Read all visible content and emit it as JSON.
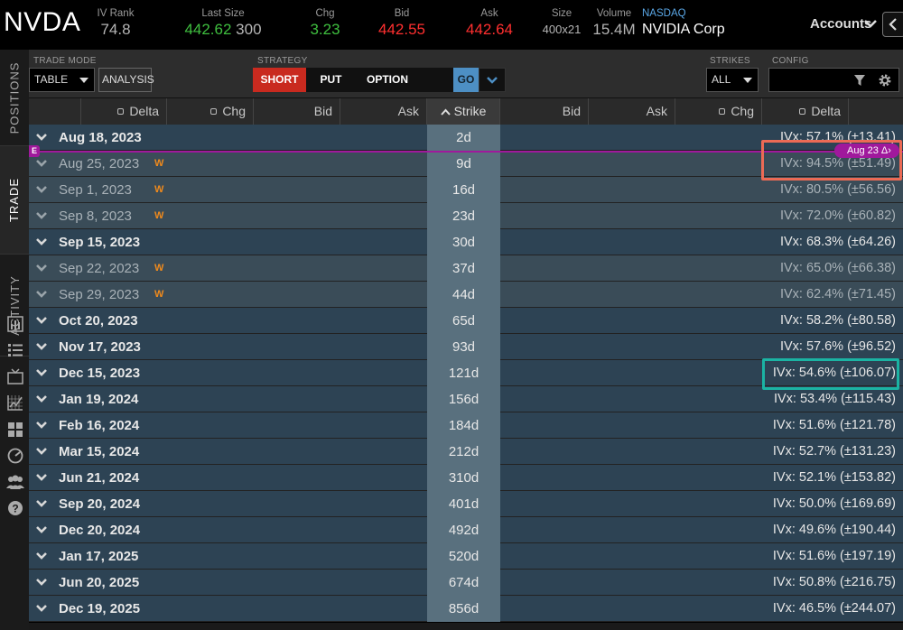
{
  "quote": {
    "symbol": "NVDA",
    "iv_rank": {
      "label": "IV Rank",
      "value": "74.8"
    },
    "last_size": {
      "label": "Last Size",
      "price": "442.62",
      "size": "300"
    },
    "chg": {
      "label": "Chg",
      "value": "3.23"
    },
    "bid": {
      "label": "Bid",
      "value": "442.55"
    },
    "ask": {
      "label": "Ask",
      "value": "442.64"
    },
    "size": {
      "label": "Size",
      "value": "400x21"
    },
    "volume": {
      "label": "Volume",
      "value": "15.4M"
    },
    "exchange": {
      "label": "NASDAQ",
      "name": "NVIDIA Corp"
    },
    "accounts_label": "Accounts"
  },
  "toolbar": {
    "trade_mode": {
      "label": "TRADE MODE",
      "value": "TABLE",
      "analysis": "ANALYSIS"
    },
    "strategy": {
      "label": "STRATEGY",
      "short": "SHORT",
      "put": "PUT",
      "option": "OPTION",
      "go": "GO"
    },
    "strikes": {
      "label": "STRIKES",
      "value": "ALL"
    },
    "config": {
      "label": "CONFIG"
    }
  },
  "rail": {
    "tabs": [
      "POSITIONS",
      "TRADE",
      "ACTIVITY"
    ],
    "icons": [
      "chart-icon",
      "list-icon",
      "tv-icon",
      "heatmap-icon",
      "grid-icon",
      "gauge-icon",
      "users-icon",
      "help-icon"
    ]
  },
  "table": {
    "headers": {
      "call_delta": "Delta",
      "call_chg": "Chg",
      "call_bid": "Bid",
      "call_ask": "Ask",
      "strike": "Strike",
      "put_bid": "Bid",
      "put_ask": "Ask",
      "put_chg": "Chg",
      "put_delta": "Delta"
    },
    "rows": [
      {
        "date": "Aug 18, 2023",
        "weekly": "",
        "dte": "2d",
        "ivx": "IVx: 57.1% (±13.41)",
        "type": "monthly"
      },
      {
        "date": "Aug 25, 2023",
        "weekly": "W",
        "dte": "9d",
        "ivx": "IVx: 94.5% (±51.49)",
        "type": "weekly"
      },
      {
        "date": "Sep 1, 2023",
        "weekly": "W",
        "dte": "16d",
        "ivx": "IVx: 80.5% (±56.56)",
        "type": "weekly"
      },
      {
        "date": "Sep 8, 2023",
        "weekly": "W",
        "dte": "23d",
        "ivx": "IVx: 72.0% (±60.82)",
        "type": "weekly"
      },
      {
        "date": "Sep 15, 2023",
        "weekly": "",
        "dte": "30d",
        "ivx": "IVx: 68.3% (±64.26)",
        "type": "monthly"
      },
      {
        "date": "Sep 22, 2023",
        "weekly": "W",
        "dte": "37d",
        "ivx": "IVx: 65.0% (±66.38)",
        "type": "weekly"
      },
      {
        "date": "Sep 29, 2023",
        "weekly": "W",
        "dte": "44d",
        "ivx": "IVx: 62.4% (±71.45)",
        "type": "weekly"
      },
      {
        "date": "Oct 20, 2023",
        "weekly": "",
        "dte": "65d",
        "ivx": "IVx: 58.2% (±80.58)",
        "type": "monthly"
      },
      {
        "date": "Nov 17, 2023",
        "weekly": "",
        "dte": "93d",
        "ivx": "IVx: 57.6% (±96.52)",
        "type": "monthly"
      },
      {
        "date": "Dec 15, 2023",
        "weekly": "",
        "dte": "121d",
        "ivx": "IVx: 54.6% (±106.07)",
        "type": "monthly"
      },
      {
        "date": "Jan 19, 2024",
        "weekly": "",
        "dte": "156d",
        "ivx": "IVx: 53.4% (±115.43)",
        "type": "monthly"
      },
      {
        "date": "Feb 16, 2024",
        "weekly": "",
        "dte": "184d",
        "ivx": "IVx: 51.6% (±121.78)",
        "type": "monthly"
      },
      {
        "date": "Mar 15, 2024",
        "weekly": "",
        "dte": "212d",
        "ivx": "IVx: 52.7% (±131.23)",
        "type": "monthly"
      },
      {
        "date": "Jun 21, 2024",
        "weekly": "",
        "dte": "310d",
        "ivx": "IVx: 52.1% (±153.82)",
        "type": "monthly"
      },
      {
        "date": "Sep 20, 2024",
        "weekly": "",
        "dte": "401d",
        "ivx": "IVx: 50.0% (±169.69)",
        "type": "monthly"
      },
      {
        "date": "Dec 20, 2024",
        "weekly": "",
        "dte": "492d",
        "ivx": "IVx: 49.6% (±190.44)",
        "type": "monthly"
      },
      {
        "date": "Jan 17, 2025",
        "weekly": "",
        "dte": "520d",
        "ivx": "IVx: 51.6% (±197.19)",
        "type": "monthly"
      },
      {
        "date": "Jun 20, 2025",
        "weekly": "",
        "dte": "674d",
        "ivx": "IVx: 50.8% (±216.75)",
        "type": "monthly"
      },
      {
        "date": "Dec 19, 2025",
        "weekly": "",
        "dte": "856d",
        "ivx": "IVx: 46.5% (±244.07)",
        "type": "monthly"
      }
    ]
  },
  "overlay": {
    "earnings_marker": "E",
    "today_pill": "Aug 23 Δ›",
    "highlight_colors": {
      "red": "#ec6a55",
      "teal": "#1bb3a3"
    }
  },
  "colors": {
    "monthly_row": "#2d4354",
    "weekly_row": "#3a4c58",
    "strike_column": "#59707e",
    "today_line": "#a0199c",
    "short_button": "#c92a1f",
    "go_button": "#4d8fc4",
    "weekly_tag": "#f08a1c"
  }
}
